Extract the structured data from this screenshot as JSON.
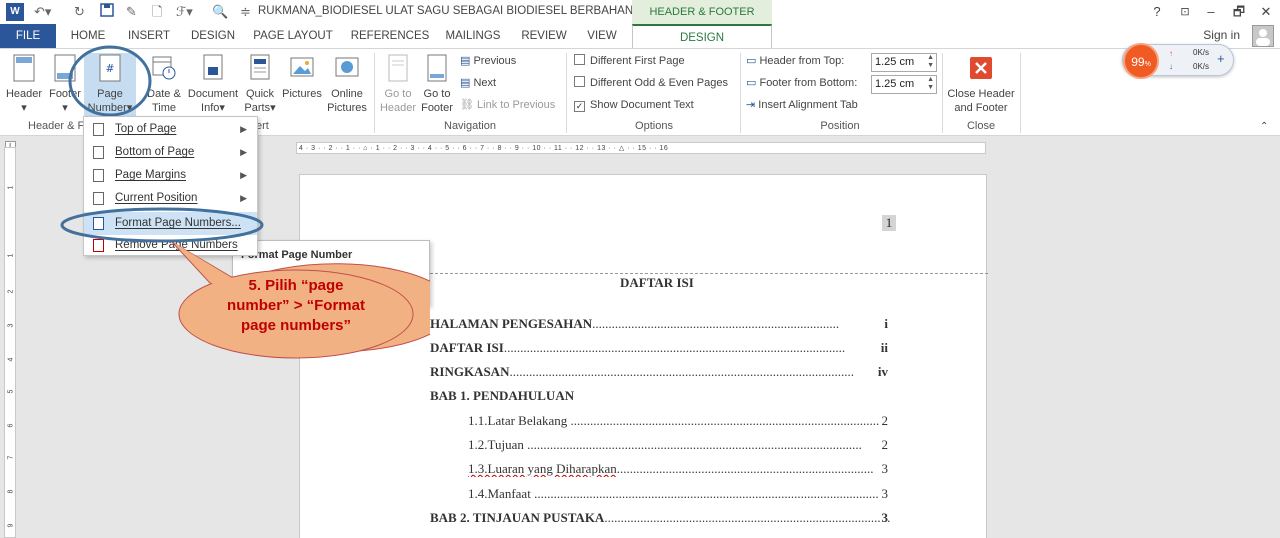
{
  "titlebar": {
    "document_title": "RUKMANA_BIODIESEL ULAT SAGU SEBAGAI BIODIESEL BERBAHAN BAK...",
    "context_tools": "HEADER & FOOTER TOOLS",
    "help": "?",
    "minimize": "–",
    "restore": "🗗",
    "close": "✕"
  },
  "tabs": [
    "FILE",
    "HOME",
    "INSERT",
    "DESIGN",
    "PAGE LAYOUT",
    "REFERENCES",
    "MAILINGS",
    "REVIEW",
    "VIEW"
  ],
  "active_tab": "DESIGN",
  "signin": "Sign in",
  "ribbon": {
    "header_label": "Header",
    "footer_label": "Footer",
    "page_number_l1": "Page",
    "page_number_l2": "Number",
    "date_time_l1": "Date &",
    "date_time_l2": "Time",
    "doc_info_l1": "Document",
    "doc_info_l2": "Info",
    "quick_parts_l1": "Quick",
    "quick_parts_l2": "Parts",
    "pictures": "Pictures",
    "online_l1": "Online",
    "online_l2": "Pictures",
    "group_hf": "Header & F",
    "group_insert": "ert",
    "goto_header_l1": "Go to",
    "goto_header_l2": "Header",
    "goto_footer_l1": "Go to",
    "goto_footer_l2": "Footer",
    "previous": "Previous",
    "next": "Next",
    "link_previous": "Link to Previous",
    "group_navigation": "Navigation",
    "opt_first_page": "Different First Page",
    "opt_odd_even": "Different Odd & Even Pages",
    "opt_show_text": "Show Document Text",
    "group_options": "Options",
    "header_from_top": "Header from Top:",
    "header_from_top_val": "1.25 cm",
    "footer_from_bottom": "Footer from Bottom:",
    "footer_from_bottom_val": "1.25 cm",
    "insert_align_tab": "Insert Alignment Tab",
    "group_position": "Position",
    "close_hf_l1": "Close Header",
    "close_hf_l2": "and Footer",
    "group_close": "Close"
  },
  "network": {
    "percent": "99",
    "unit": "%",
    "up": "0K/s",
    "down": "0K/s"
  },
  "menu": {
    "items": [
      {
        "label": "Top of Page",
        "has_sub": true
      },
      {
        "label": "Bottom of Page",
        "has_sub": true
      },
      {
        "label": "Page Margins",
        "has_sub": true
      },
      {
        "label": "Current Position",
        "has_sub": true
      },
      {
        "label": "Format Page Numbers...",
        "has_sub": false
      },
      {
        "label": "Remove Page Numbers",
        "has_sub": false
      }
    ]
  },
  "tooltip": {
    "title": "Format Page Number",
    "description": "umbers"
  },
  "callout": {
    "text": "5. Pilih “page number” > “Format page numbers”"
  },
  "ruler": {
    "horizontal": "4 · 3 · · 2 · · 1 · · ⌂ · 1 · · 2 · · 3 · · 4 · · 5 · · 6 · · 7 · · 8 · · 9 · · 10 · · 11 · · 12 · · 13 · · △ · · 15 · · 16",
    "vertical": [
      "1",
      "1",
      "2",
      "3",
      "4",
      "5",
      "6",
      "7",
      "8",
      "9"
    ]
  },
  "document": {
    "page_number": "1",
    "title": "DAFTAR ISI",
    "toc": [
      {
        "text": "HALAMAN PENGESAHAN",
        "page": "i",
        "bold": true,
        "indent": false
      },
      {
        "text": "DAFTAR ISI",
        "page": "ii",
        "bold": true,
        "indent": false
      },
      {
        "text": "RINGKASAN",
        "page": "iv",
        "bold": true,
        "indent": false
      },
      {
        "text": "BAB 1. PENDAHULUAN",
        "page": "",
        "bold": true,
        "indent": false
      },
      {
        "text": "1.1.Latar Belakang",
        "page": "2",
        "bold": false,
        "indent": true
      },
      {
        "text": "1.2.Tujuan",
        "page": "2",
        "bold": false,
        "indent": true
      },
      {
        "text": "1.3.Luaran yang Diharapkan",
        "page": "3",
        "bold": false,
        "indent": true
      },
      {
        "text": "1.4.Manfaat",
        "page": "3",
        "bold": false,
        "indent": true
      },
      {
        "text": "BAB 2. TINJAUAN PUSTAKA",
        "page": "3",
        "bold": true,
        "indent": false
      }
    ]
  },
  "colors": {
    "accent": "#2b579a",
    "context": "#2b7a3d",
    "callout_fill": "#f2b183",
    "callout_text": "#c00000",
    "highlight_ring": "#41719c"
  }
}
